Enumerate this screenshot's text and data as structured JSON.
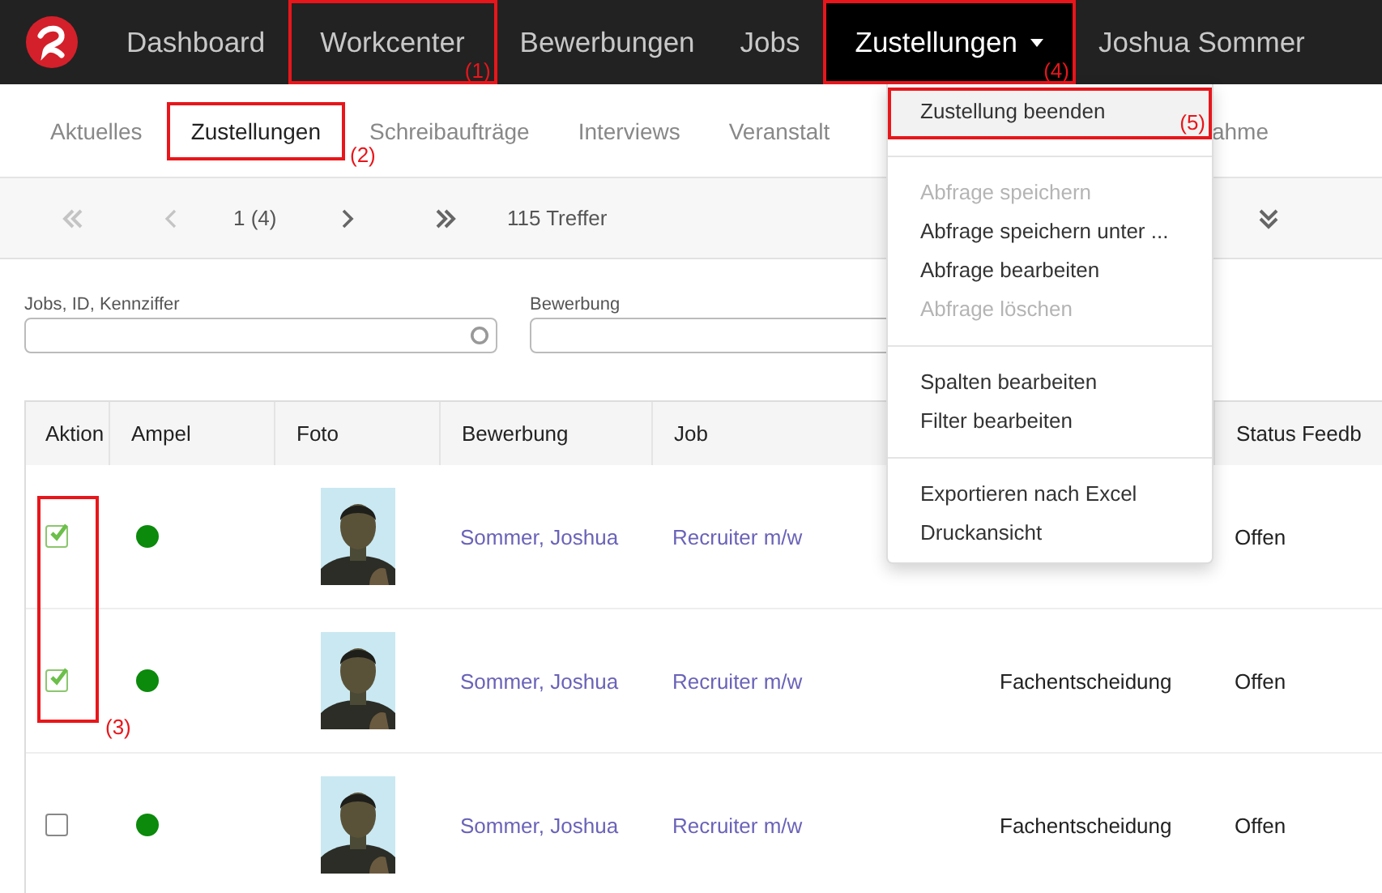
{
  "nav": {
    "items": [
      {
        "label": "Dashboard",
        "active": false
      },
      {
        "label": "Workcenter",
        "active": false,
        "callout": "(1)"
      },
      {
        "label": "Bewerbungen",
        "active": false
      },
      {
        "label": "Jobs",
        "active": false
      },
      {
        "label": "Zustellungen",
        "active": true,
        "caret": true,
        "callout": "(4)"
      },
      {
        "label": "Joshua Sommer",
        "active": false
      }
    ]
  },
  "tabs": [
    {
      "label": "Aktuelles",
      "selected": false
    },
    {
      "label": "Zustellungen",
      "selected": true,
      "callout": "(2)"
    },
    {
      "label": "Schreibaufträge",
      "selected": false
    },
    {
      "label": "Interviews",
      "selected": false
    },
    {
      "label": "Veranstalt",
      "selected": false
    },
    {
      "label": "ahme",
      "selected": false
    }
  ],
  "pager": {
    "page": "1 (4)",
    "hits": "115 Treffer"
  },
  "filters": [
    {
      "label": "Jobs, ID, Kennziffer",
      "search": true
    },
    {
      "label": "Bewerbung"
    }
  ],
  "table": {
    "columns": [
      "Aktion",
      "Ampel",
      "Foto",
      "Bewerbung",
      "Job",
      "",
      "Status Feedb"
    ],
    "checkbox_callout": "(3)",
    "rows": [
      {
        "checked": true,
        "color": "#0b8a0b",
        "applicant": "Sommer, Joshua",
        "job": "Recruiter m/w",
        "status": "Offen"
      },
      {
        "checked": true,
        "color": "#0b8a0b",
        "applicant": "Sommer, Joshua",
        "job": "Recruiter m/w",
        "decision": "Fachentscheidung",
        "status": "Offen"
      },
      {
        "checked": false,
        "color": "#0b8a0b",
        "applicant": "Sommer, Joshua",
        "job": "Recruiter m/w",
        "decision": "Fachentscheidung",
        "status": "Offen"
      }
    ]
  },
  "menu": {
    "items": [
      {
        "kind": "item",
        "label": "Zustellung beenden",
        "disabled": false,
        "highlighted": true,
        "callout": "(5)"
      },
      {
        "kind": "divider"
      },
      {
        "kind": "item",
        "label": "Abfrage speichern",
        "disabled": true
      },
      {
        "kind": "item",
        "label": "Abfrage speichern unter ...",
        "disabled": false
      },
      {
        "kind": "item",
        "label": "Abfrage bearbeiten",
        "disabled": false
      },
      {
        "kind": "item",
        "label": "Abfrage löschen",
        "disabled": true
      },
      {
        "kind": "divider"
      },
      {
        "kind": "item",
        "label": "Spalten bearbeiten",
        "disabled": false
      },
      {
        "kind": "item",
        "label": "Filter bearbeiten",
        "disabled": false
      },
      {
        "kind": "divider"
      },
      {
        "kind": "item",
        "label": "Exportieren nach Excel",
        "disabled": false
      },
      {
        "kind": "item",
        "label": "Druckansicht",
        "disabled": false
      }
    ]
  }
}
